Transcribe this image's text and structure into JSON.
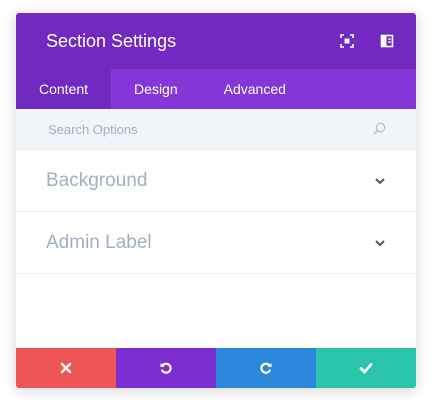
{
  "header": {
    "title": "Section Settings",
    "icons": [
      "fullscreen-icon",
      "sidebar-layout-icon"
    ]
  },
  "tabs": [
    {
      "label": "Content",
      "active": true
    },
    {
      "label": "Design",
      "active": false
    },
    {
      "label": "Advanced",
      "active": false
    }
  ],
  "search": {
    "placeholder": "Search Options",
    "value": ""
  },
  "sections": [
    {
      "label": "Background"
    },
    {
      "label": "Admin Label"
    }
  ],
  "footer": {
    "buttons": [
      {
        "name": "cancel",
        "icon": "close-icon",
        "color": "#ef5555"
      },
      {
        "name": "undo",
        "icon": "undo-icon",
        "color": "#7d2ed3"
      },
      {
        "name": "redo",
        "icon": "redo-icon",
        "color": "#2b87da"
      },
      {
        "name": "save",
        "icon": "check-icon",
        "color": "#29c4a9"
      }
    ]
  },
  "colors": {
    "header_bg": "#7129c1",
    "tabs_bg": "#8436d9",
    "search_bg": "#f1f5f9",
    "muted_text": "#a2b0c1"
  }
}
